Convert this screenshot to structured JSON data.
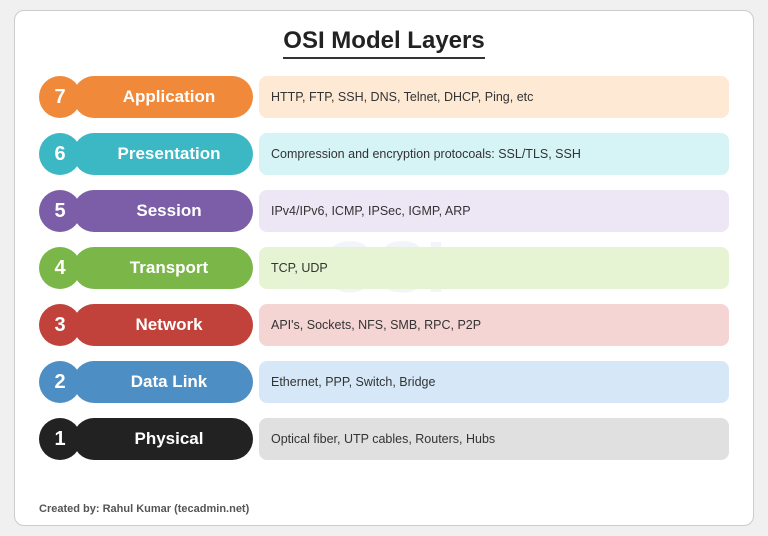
{
  "title": "OSI Model Layers",
  "watermark": "OSI",
  "layers": [
    {
      "number": "7",
      "name": "Application",
      "description": "HTTP, FTP, SSH, DNS, Telnet, DHCP, Ping, etc",
      "class": "layer-7"
    },
    {
      "number": "6",
      "name": "Presentation",
      "description": "Compression and encryption protocoals: SSL/TLS, SSH",
      "class": "layer-6"
    },
    {
      "number": "5",
      "name": "Session",
      "description": "IPv4/IPv6, ICMP, IPSec, IGMP, ARP",
      "class": "layer-5"
    },
    {
      "number": "4",
      "name": "Transport",
      "description": "TCP, UDP",
      "class": "layer-4"
    },
    {
      "number": "3",
      "name": "Network",
      "description": "API's, Sockets, NFS, SMB, RPC, P2P",
      "class": "layer-3"
    },
    {
      "number": "2",
      "name": "Data Link",
      "description": "Ethernet, PPP, Switch, Bridge",
      "class": "layer-2"
    },
    {
      "number": "1",
      "name": "Physical",
      "description": "Optical fiber, UTP cables, Routers, Hubs",
      "class": "layer-1"
    }
  ],
  "footer": {
    "prefix": "Created by: ",
    "author": "Rahul Kumar (tecadmin.net)"
  }
}
